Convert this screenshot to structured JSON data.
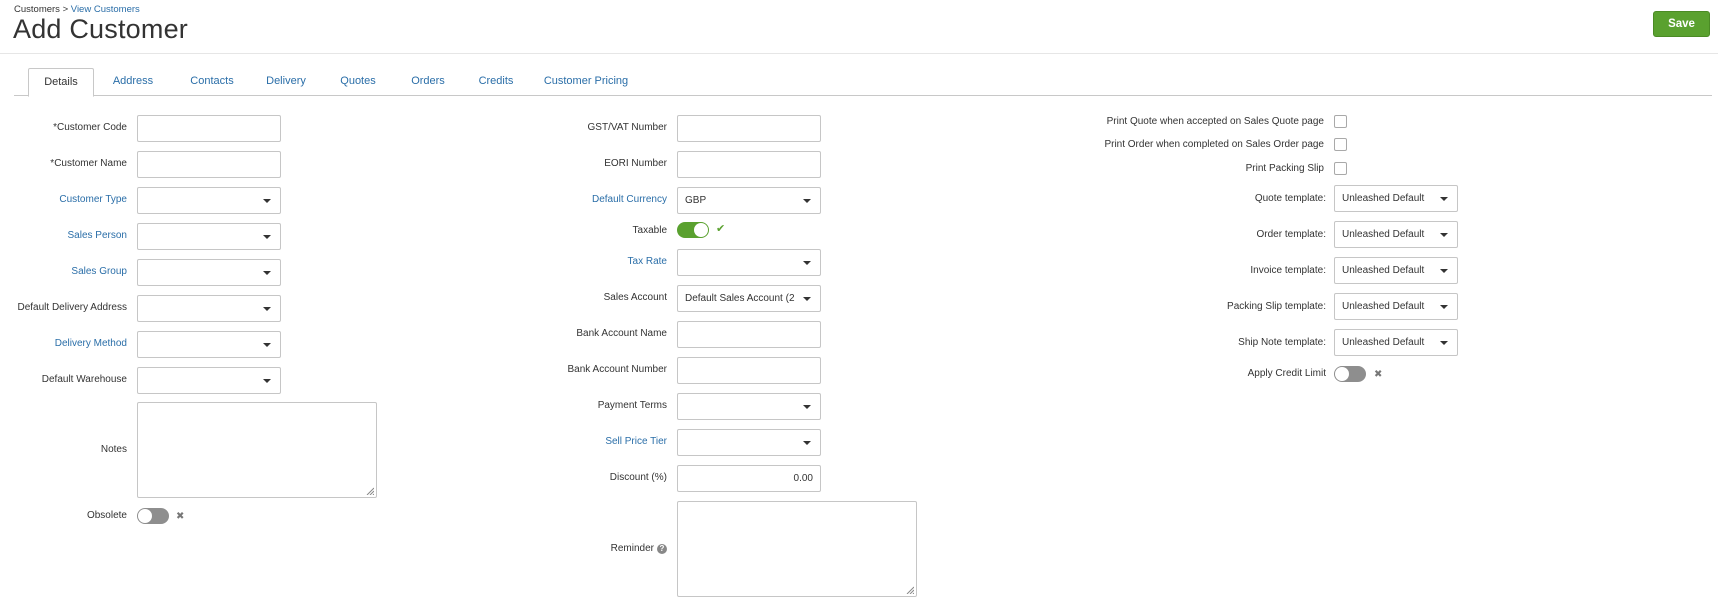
{
  "breadcrumb": {
    "root": "Customers",
    "separator": ">",
    "current": "View Customers"
  },
  "page_title": "Add Customer",
  "save_label": "Save",
  "tabs": [
    "Details",
    "Address",
    "Contacts",
    "Delivery",
    "Quotes",
    "Orders",
    "Credits",
    "Customer Pricing"
  ],
  "active_tab": "Details",
  "left": {
    "customer_code": {
      "required": "*",
      "label": "Customer Code",
      "value": ""
    },
    "customer_name": {
      "required": "*",
      "label": "Customer Name",
      "value": ""
    },
    "customer_type": {
      "label": "Customer Type",
      "value": ""
    },
    "sales_person": {
      "label": "Sales Person",
      "value": ""
    },
    "sales_group": {
      "label": "Sales Group",
      "value": ""
    },
    "default_delivery_address": {
      "label": "Default Delivery Address",
      "value": ""
    },
    "delivery_method": {
      "label": "Delivery Method",
      "value": ""
    },
    "default_warehouse": {
      "label": "Default Warehouse",
      "value": ""
    },
    "notes": {
      "label": "Notes",
      "value": ""
    },
    "obsolete": {
      "label": "Obsolete",
      "on": false
    }
  },
  "middle": {
    "gst_vat": {
      "label": "GST/VAT Number",
      "value": ""
    },
    "eori": {
      "label": "EORI Number",
      "value": ""
    },
    "default_currency": {
      "label": "Default Currency",
      "value": "GBP"
    },
    "taxable": {
      "label": "Taxable",
      "on": true
    },
    "tax_rate": {
      "label": "Tax Rate",
      "value": ""
    },
    "sales_account": {
      "label": "Sales Account",
      "value": "Default Sales Account (2"
    },
    "bank_account_name": {
      "label": "Bank Account Name",
      "value": ""
    },
    "bank_account_number": {
      "label": "Bank Account Number",
      "value": ""
    },
    "payment_terms": {
      "label": "Payment Terms",
      "value": ""
    },
    "sell_price_tier": {
      "label": "Sell Price Tier",
      "value": ""
    },
    "discount": {
      "label": "Discount (%)",
      "value": "0.00"
    },
    "reminder": {
      "label": "Reminder",
      "value": ""
    }
  },
  "right": {
    "print_quote": {
      "label": "Print Quote when accepted on Sales Quote page",
      "checked": false
    },
    "print_order": {
      "label": "Print Order when completed on Sales Order page",
      "checked": false
    },
    "print_packing_slip": {
      "label": "Print Packing Slip",
      "checked": false
    },
    "quote_template": {
      "label": "Quote template:",
      "value": "Unleashed Default"
    },
    "order_template": {
      "label": "Order template:",
      "value": "Unleashed Default"
    },
    "invoice_template": {
      "label": "Invoice template:",
      "value": "Unleashed Default"
    },
    "packing_slip_template": {
      "label": "Packing Slip template:",
      "value": "Unleashed Default"
    },
    "ship_note_template": {
      "label": "Ship Note template:",
      "value": "Unleashed Default"
    },
    "apply_credit_limit": {
      "label": "Apply Credit Limit",
      "on": false
    }
  },
  "icons": {
    "dropdown": "chevron-down-icon",
    "check": "checkmark-icon",
    "cross": "cross-icon",
    "help": "question-circle-icon",
    "resize": "resize-grip-icon"
  },
  "colors": {
    "accent": "#5aa12f",
    "link": "#2a6ea8",
    "text": "#333333",
    "border": "#c6c6c6",
    "toggle_off": "#8e8e8e"
  }
}
